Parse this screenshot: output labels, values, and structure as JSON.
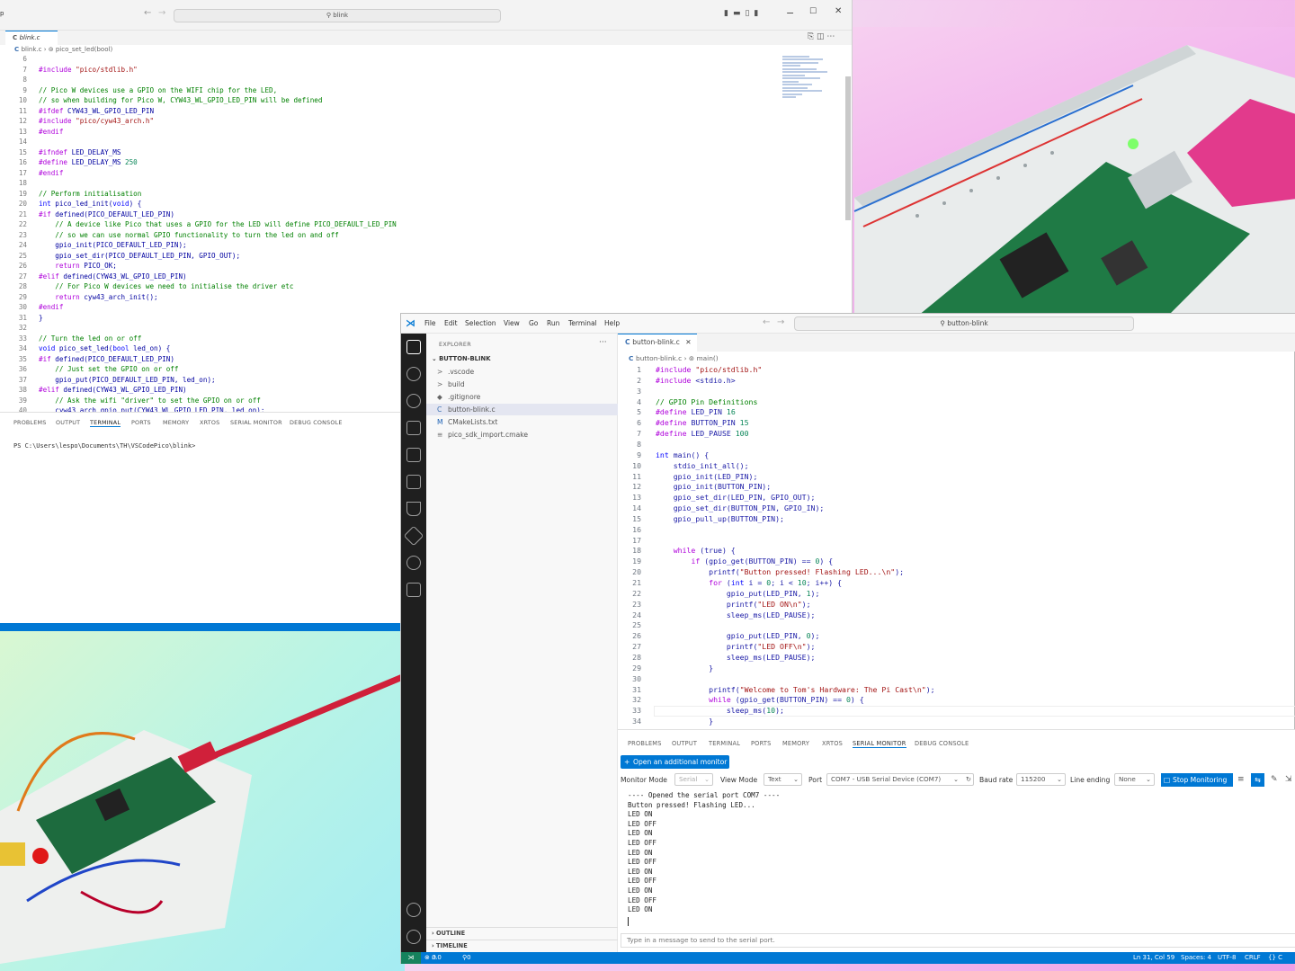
{
  "colors": {
    "accent": "#0078d4",
    "keyword": "#af00db",
    "comment": "#008000",
    "string": "#a31515",
    "number": "#098658"
  },
  "window1": {
    "title_fragment": "p",
    "search": "blink",
    "tab": "blink.c",
    "breadcrumb": [
      "blink.c",
      "pico_set_led(bool)"
    ],
    "code": [
      {
        "n": "6",
        "t": ""
      },
      {
        "n": "7",
        "t": "#include \"pico/stdlib.h\""
      },
      {
        "n": "8",
        "t": ""
      },
      {
        "n": "9",
        "t": "// Pico W devices use a GPIO on the WIFI chip for the LED,"
      },
      {
        "n": "10",
        "t": "// so when building for Pico W, CYW43_WL_GPIO_LED_PIN will be defined"
      },
      {
        "n": "11",
        "t": "#ifdef CYW43_WL_GPIO_LED_PIN"
      },
      {
        "n": "12",
        "t": "#include \"pico/cyw43_arch.h\""
      },
      {
        "n": "13",
        "t": "#endif"
      },
      {
        "n": "14",
        "t": ""
      },
      {
        "n": "15",
        "t": "#ifndef LED_DELAY_MS"
      },
      {
        "n": "16",
        "t": "#define LED_DELAY_MS 250"
      },
      {
        "n": "17",
        "t": "#endif"
      },
      {
        "n": "18",
        "t": ""
      },
      {
        "n": "19",
        "t": "// Perform initialisation"
      },
      {
        "n": "20",
        "t": "int pico_led_init(void) {"
      },
      {
        "n": "21",
        "t": "#if defined(PICO_DEFAULT_LED_PIN)"
      },
      {
        "n": "22",
        "t": "    // A device like Pico that uses a GPIO for the LED will define PICO_DEFAULT_LED_PIN"
      },
      {
        "n": "23",
        "t": "    // so we can use normal GPIO functionality to turn the led on and off"
      },
      {
        "n": "24",
        "t": "    gpio_init(PICO_DEFAULT_LED_PIN);"
      },
      {
        "n": "25",
        "t": "    gpio_set_dir(PICO_DEFAULT_LED_PIN, GPIO_OUT);"
      },
      {
        "n": "26",
        "t": "    return PICO_OK;"
      },
      {
        "n": "27",
        "t": "#elif defined(CYW43_WL_GPIO_LED_PIN)"
      },
      {
        "n": "28",
        "t": "    // For Pico W devices we need to initialise the driver etc"
      },
      {
        "n": "29",
        "t": "    return cyw43_arch_init();"
      },
      {
        "n": "30",
        "t": "#endif"
      },
      {
        "n": "31",
        "t": "}"
      },
      {
        "n": "32",
        "t": ""
      },
      {
        "n": "33",
        "t": "// Turn the led on or off"
      },
      {
        "n": "34",
        "t": "void pico_set_led(bool led_on) {"
      },
      {
        "n": "35",
        "t": "#if defined(PICO_DEFAULT_LED_PIN)"
      },
      {
        "n": "36",
        "t": "    // Just set the GPIO on or off"
      },
      {
        "n": "37",
        "t": "    gpio_put(PICO_DEFAULT_LED_PIN, led_on);"
      },
      {
        "n": "38",
        "t": "#elif defined(CYW43_WL_GPIO_LED_PIN)"
      },
      {
        "n": "39",
        "t": "    // Ask the wifi \"driver\" to set the GPIO on or off"
      },
      {
        "n": "40",
        "t": "    cyw43_arch_gpio_put(CYW43_WL_GPIO_LED_PIN, led_on);"
      }
    ],
    "panel_tabs": [
      "PROBLEMS",
      "OUTPUT",
      "TERMINAL",
      "PORTS",
      "MEMORY",
      "XRTOS",
      "SERIAL MONITOR",
      "DEBUG CONSOLE"
    ],
    "terminal_prompt": "PS C:\\Users\\lespo\\Documents\\TH\\VSCodePico\\blink>"
  },
  "window2": {
    "menu": [
      "File",
      "Edit",
      "Selection",
      "View",
      "Go",
      "Run",
      "Terminal",
      "Help"
    ],
    "search": "button-blink",
    "explorer_title": "EXPLORER",
    "explorer_more": "···",
    "project": "BUTTON-BLINK",
    "files": [
      {
        "icon": ">",
        "name": ".vscode"
      },
      {
        "icon": ">",
        "name": "build"
      },
      {
        "icon": "◆",
        "name": ".gitignore"
      },
      {
        "icon": "C",
        "name": "button-blink.c"
      },
      {
        "icon": "M",
        "name": "CMakeLists.txt"
      },
      {
        "icon": "≡",
        "name": "pico_sdk_import.cmake"
      }
    ],
    "outline": "OUTLINE",
    "timeline": "TIMELINE",
    "tab": "button-blink.c",
    "breadcrumb": [
      "button-blink.c",
      "main()"
    ],
    "code": [
      {
        "n": "1",
        "t": "#include \"pico/stdlib.h\""
      },
      {
        "n": "2",
        "t": "#include <stdio.h>"
      },
      {
        "n": "3",
        "t": ""
      },
      {
        "n": "4",
        "t": "// GPIO Pin Definitions"
      },
      {
        "n": "5",
        "t": "#define LED_PIN 16"
      },
      {
        "n": "6",
        "t": "#define BUTTON_PIN 15"
      },
      {
        "n": "7",
        "t": "#define LED_PAUSE 100"
      },
      {
        "n": "8",
        "t": ""
      },
      {
        "n": "9",
        "t": "int main() {"
      },
      {
        "n": "10",
        "t": "    stdio_init_all();"
      },
      {
        "n": "11",
        "t": "    gpio_init(LED_PIN);"
      },
      {
        "n": "12",
        "t": "    gpio_init(BUTTON_PIN);"
      },
      {
        "n": "13",
        "t": "    gpio_set_dir(LED_PIN, GPIO_OUT);"
      },
      {
        "n": "14",
        "t": "    gpio_set_dir(BUTTON_PIN, GPIO_IN);"
      },
      {
        "n": "15",
        "t": "    gpio_pull_up(BUTTON_PIN);"
      },
      {
        "n": "16",
        "t": ""
      },
      {
        "n": "17",
        "t": ""
      },
      {
        "n": "18",
        "t": "    while (true) {"
      },
      {
        "n": "19",
        "t": "        if (gpio_get(BUTTON_PIN) == 0) {"
      },
      {
        "n": "20",
        "t": "            printf(\"Button pressed! Flashing LED...\\n\");"
      },
      {
        "n": "21",
        "t": "            for (int i = 0; i < 10; i++) {"
      },
      {
        "n": "22",
        "t": "                gpio_put(LED_PIN, 1);"
      },
      {
        "n": "23",
        "t": "                printf(\"LED ON\\n\");"
      },
      {
        "n": "24",
        "t": "                sleep_ms(LED_PAUSE);"
      },
      {
        "n": "25",
        "t": ""
      },
      {
        "n": "26",
        "t": "                gpio_put(LED_PIN, 0);"
      },
      {
        "n": "27",
        "t": "                printf(\"LED OFF\\n\");"
      },
      {
        "n": "28",
        "t": "                sleep_ms(LED_PAUSE);"
      },
      {
        "n": "29",
        "t": "            }"
      },
      {
        "n": "30",
        "t": ""
      },
      {
        "n": "31",
        "t": "            printf(\"Welcome to Tom's Hardware: The Pi Cast\\n\");"
      },
      {
        "n": "32",
        "t": "            while (gpio_get(BUTTON_PIN) == 0) {"
      },
      {
        "n": "33",
        "t": "                sleep_ms(10);"
      },
      {
        "n": "34",
        "t": "            }"
      }
    ],
    "panel_tabs": [
      "PROBLEMS",
      "OUTPUT",
      "TERMINAL",
      "PORTS",
      "MEMORY",
      "XRTOS",
      "SERIAL MONITOR",
      "DEBUG CONSOLE"
    ],
    "open_monitor": "Open an additional monitor",
    "monitor_mode_label": "Monitor Mode",
    "monitor_mode_value": "Serial",
    "view_mode_label": "View Mode",
    "view_mode_value": "Text",
    "port_label": "Port",
    "port_value": "COM7 - USB Serial Device (COM7)",
    "baud_label": "Baud rate",
    "baud_value": "115200",
    "line_ending_label": "Line ending",
    "line_ending_value": "None",
    "stop_monitoring": "Stop Monitoring",
    "serial_output": "---- Opened the serial port COM7 ----\nButton pressed! Flashing LED...\nLED ON\nLED OFF\nLED ON\nLED OFF\nLED ON\nLED OFF\nLED ON\nLED OFF\nLED ON\nLED OFF\nLED ON",
    "message_placeholder": "Type in a message to send to the serial port.",
    "status": {
      "errors": "0",
      "warnings": "0",
      "ports": "0",
      "position": "Ln 31, Col 59",
      "spaces": "Spaces: 4",
      "encoding": "UTF-8",
      "eol": "CRLF",
      "lang": "{} C"
    }
  }
}
